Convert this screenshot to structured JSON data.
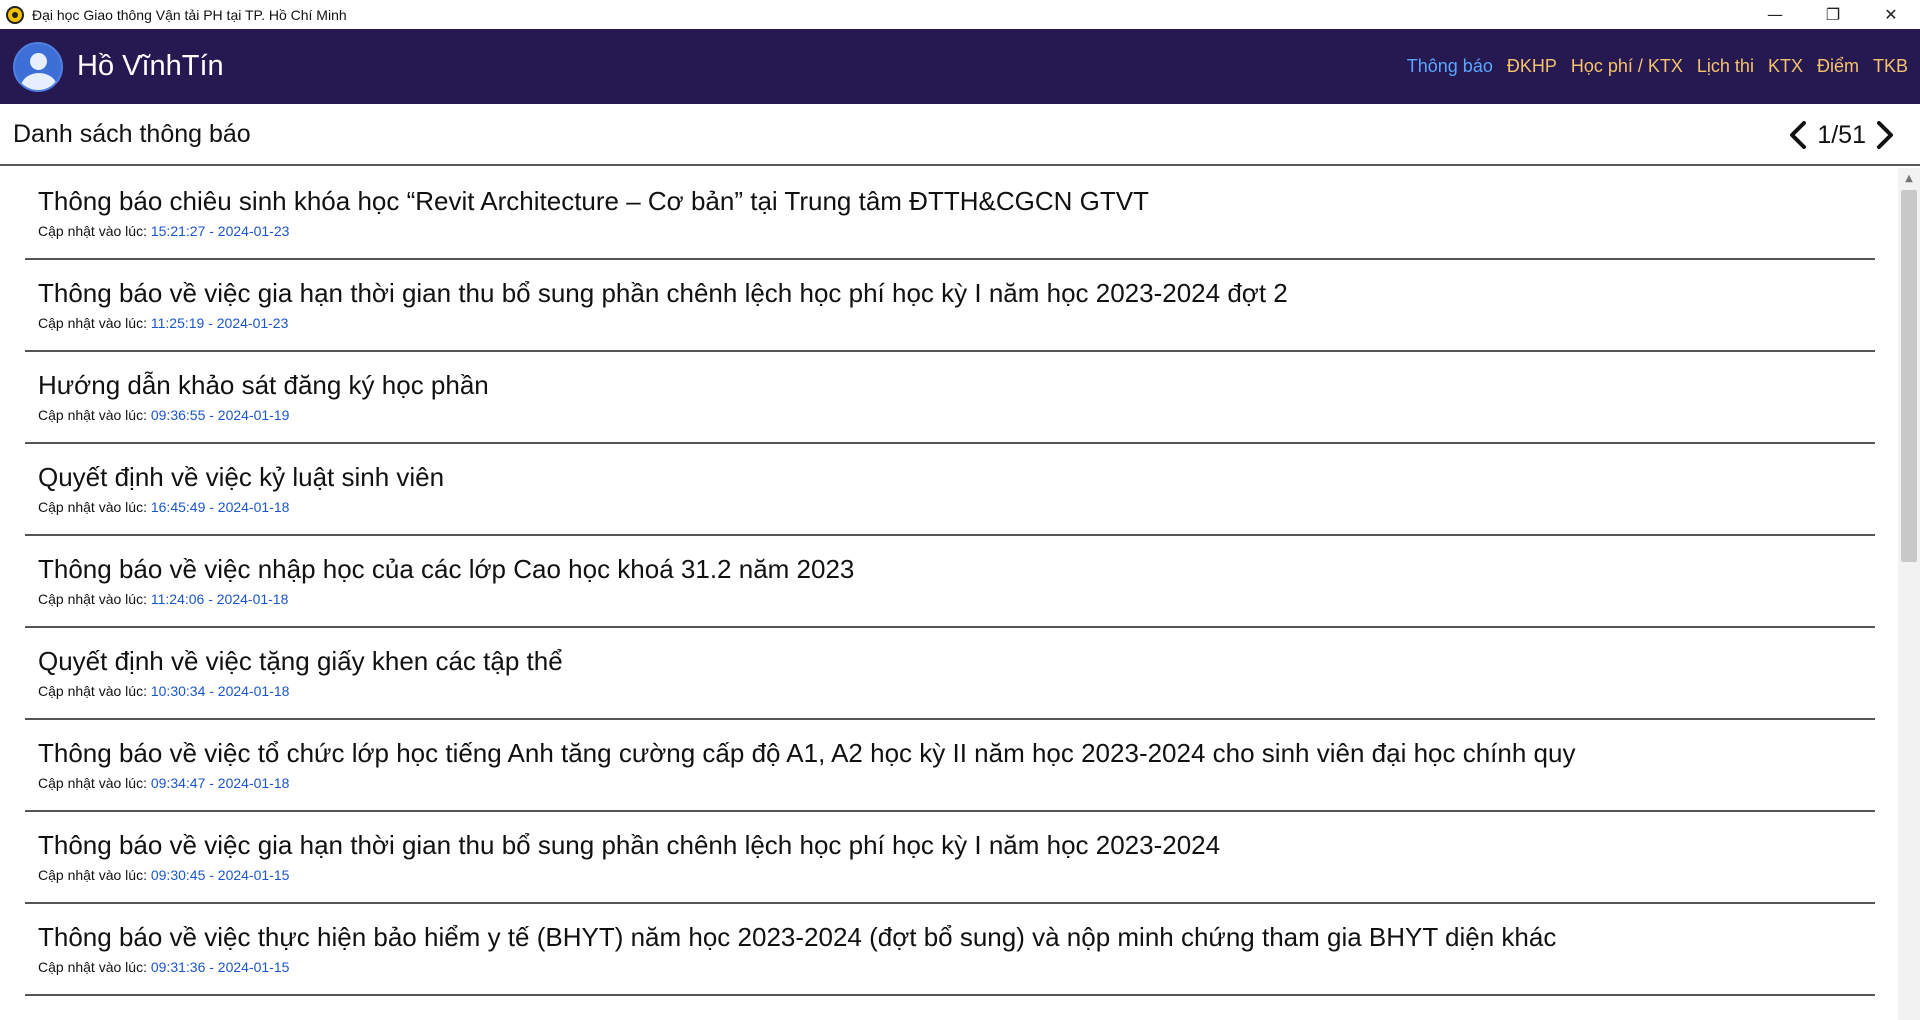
{
  "window": {
    "title": "Đại học Giao thông Vận tải PH tại TP. Hồ Chí Minh",
    "controls": {
      "minimize": "—",
      "restore": "❐",
      "close": "✕"
    }
  },
  "header": {
    "user_name": "Hồ VĩnhTín",
    "nav": [
      {
        "label": "Thông báo",
        "active": true
      },
      {
        "label": "ĐKHP"
      },
      {
        "label": "Học phí / KTX"
      },
      {
        "label": "Lịch thi"
      },
      {
        "label": "KTX"
      },
      {
        "label": "Điểm"
      },
      {
        "label": "TKB"
      }
    ]
  },
  "page": {
    "title": "Danh sách thông báo",
    "pager": "1/51"
  },
  "notices": [
    {
      "title": "Thông báo chiêu sinh khóa học “Revit Architecture – Cơ bản” tại Trung tâm ĐTTH&CGCN GTVT",
      "label": "Cập nhật vào lúc:",
      "time": "15:21:27 - 2024-01-23"
    },
    {
      "title": "Thông báo về việc gia hạn thời gian thu bổ sung phần chênh lệch học phí học kỳ I năm học 2023-2024 đợt 2",
      "label": "Cập nhật vào lúc:",
      "time": "11:25:19 - 2024-01-23"
    },
    {
      "title": "Hướng dẫn khảo sát đăng ký học phần",
      "label": "Cập nhật vào lúc:",
      "time": "09:36:55 - 2024-01-19"
    },
    {
      "title": "Quyết định về việc kỷ luật sinh viên",
      "label": "Cập nhật vào lúc:",
      "time": "16:45:49 - 2024-01-18"
    },
    {
      "title": "Thông báo về việc nhập học của các lớp Cao học khoá 31.2 năm 2023",
      "label": "Cập nhật vào lúc:",
      "time": "11:24:06 - 2024-01-18"
    },
    {
      "title": "Quyết định về việc tặng giấy khen các tập thể",
      "label": "Cập nhật vào lúc:",
      "time": "10:30:34 - 2024-01-18"
    },
    {
      "title": "Thông báo về việc tổ chức lớp học tiếng Anh tăng cường cấp độ A1, A2 học kỳ II năm học 2023-2024 cho sinh viên đại học chính quy",
      "label": "Cập nhật vào lúc:",
      "time": "09:34:47 - 2024-01-18"
    },
    {
      "title": "Thông báo về việc gia hạn thời gian thu bổ sung phần chênh lệch học phí học kỳ I năm học 2023-2024",
      "label": "Cập nhật vào lúc:",
      "time": "09:30:45 - 2024-01-15"
    },
    {
      "title": "Thông báo về việc thực hiện bảo hiểm y tế (BHYT) năm học 2023-2024 (đợt bổ sung) và nộp minh chứng tham gia BHYT diện khác",
      "label": "Cập nhật vào lúc:",
      "time": "09:31:36 - 2024-01-15"
    }
  ],
  "icons": {
    "app": "university-logo-icon",
    "avatar": "user-avatar-icon",
    "prev": "chevron-left-icon",
    "next": "chevron-right-icon"
  },
  "colors": {
    "header_bg": "#261951",
    "nav_text": "#f5c36b",
    "nav_active": "#5aa6ff",
    "timestamp": "#1a56c9"
  }
}
